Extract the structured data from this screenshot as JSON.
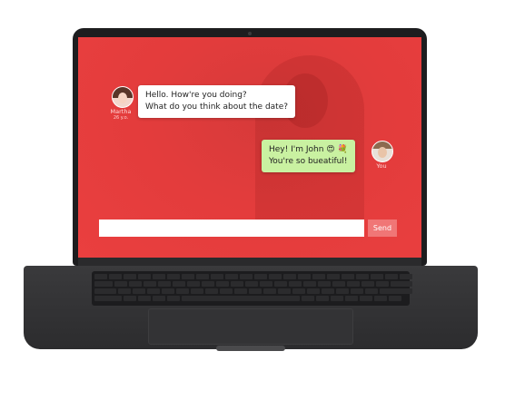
{
  "chat": {
    "incoming": {
      "name": "Martha",
      "age": "26 y.o.",
      "lines": [
        "Hello. How're you doing?",
        "What do you think about the date?"
      ]
    },
    "outgoing": {
      "name": "You",
      "lines": [
        "Hey! I'm John 😍 💐",
        "You're so bueatiful!"
      ]
    },
    "composer": {
      "value": "",
      "placeholder": ""
    },
    "send_label": "Send"
  },
  "colors": {
    "screen_background": "#e33c3c",
    "incoming_bubble": "#ffffff",
    "outgoing_bubble": "#c9f1a1",
    "send_button": "#f07676",
    "laptop_body": "#2c2c2e"
  }
}
